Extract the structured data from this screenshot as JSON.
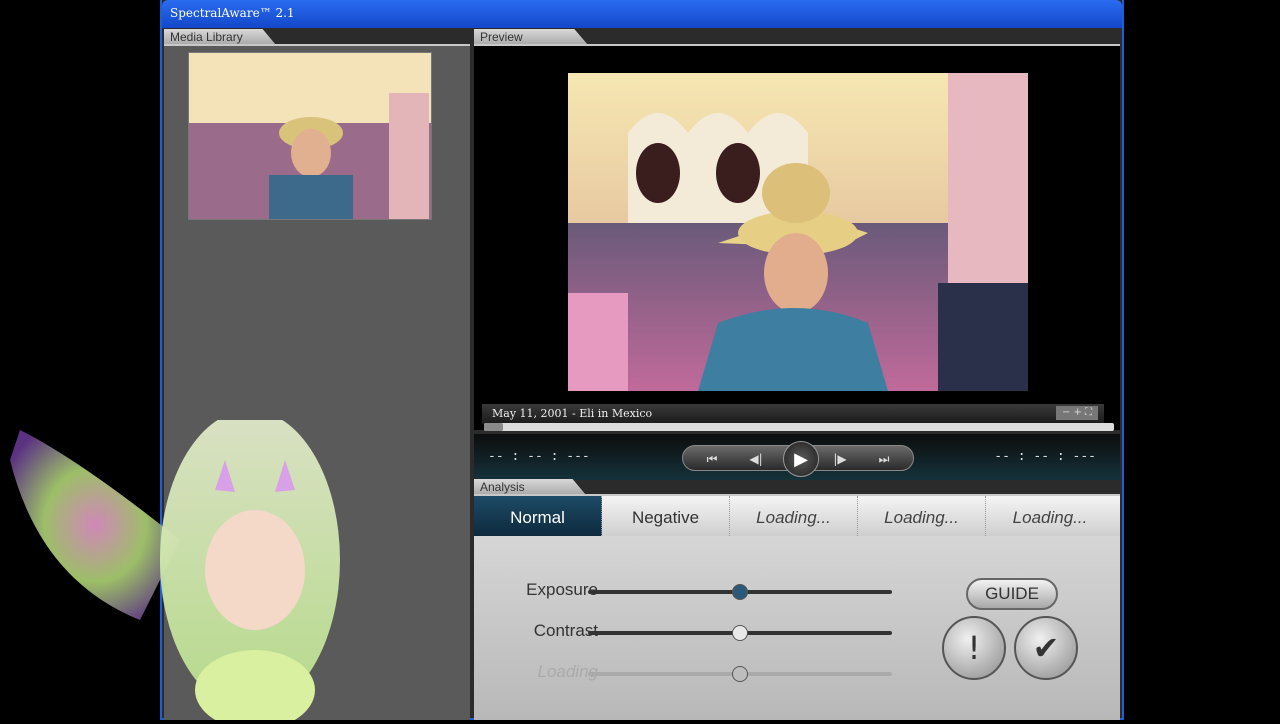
{
  "window": {
    "title": "SpectralAware™ 2.1"
  },
  "library": {
    "tab_label": "Media Library"
  },
  "preview": {
    "tab_label": "Preview",
    "caption": "May 11, 2001 - Eli in Mexico",
    "zoom_controls": "− + ⛶"
  },
  "playback": {
    "progress_fraction": 0.03,
    "time_left": "-- : -- : ---",
    "time_right": "-- : -- : ---",
    "icons": [
      "skip-back-icon",
      "step-back-icon",
      "play-icon",
      "step-forward-icon",
      "skip-forward-icon"
    ]
  },
  "analysis": {
    "tab_label": "Analysis",
    "tabs": [
      {
        "label": "Normal",
        "state": "active"
      },
      {
        "label": "Negative",
        "state": "idle"
      },
      {
        "label": "Loading...",
        "state": "loading"
      },
      {
        "label": "Loading...",
        "state": "loading"
      },
      {
        "label": "Loading...",
        "state": "loading"
      }
    ],
    "sliders": [
      {
        "label": "Exposure",
        "value": 0.5,
        "knob_color": "#2a5a78"
      },
      {
        "label": "Contrast",
        "value": 0.5,
        "knob_color": "#e8e8e8"
      },
      {
        "label": "Loading",
        "value": 0.5,
        "knob_color": "#bdbdbd"
      }
    ],
    "guide_label": "GUIDE",
    "alert_symbol": "!",
    "confirm_symbol": "✔"
  },
  "colors": {
    "titlebar": "#1f5fd6",
    "active_tab": "#1d4a66"
  }
}
